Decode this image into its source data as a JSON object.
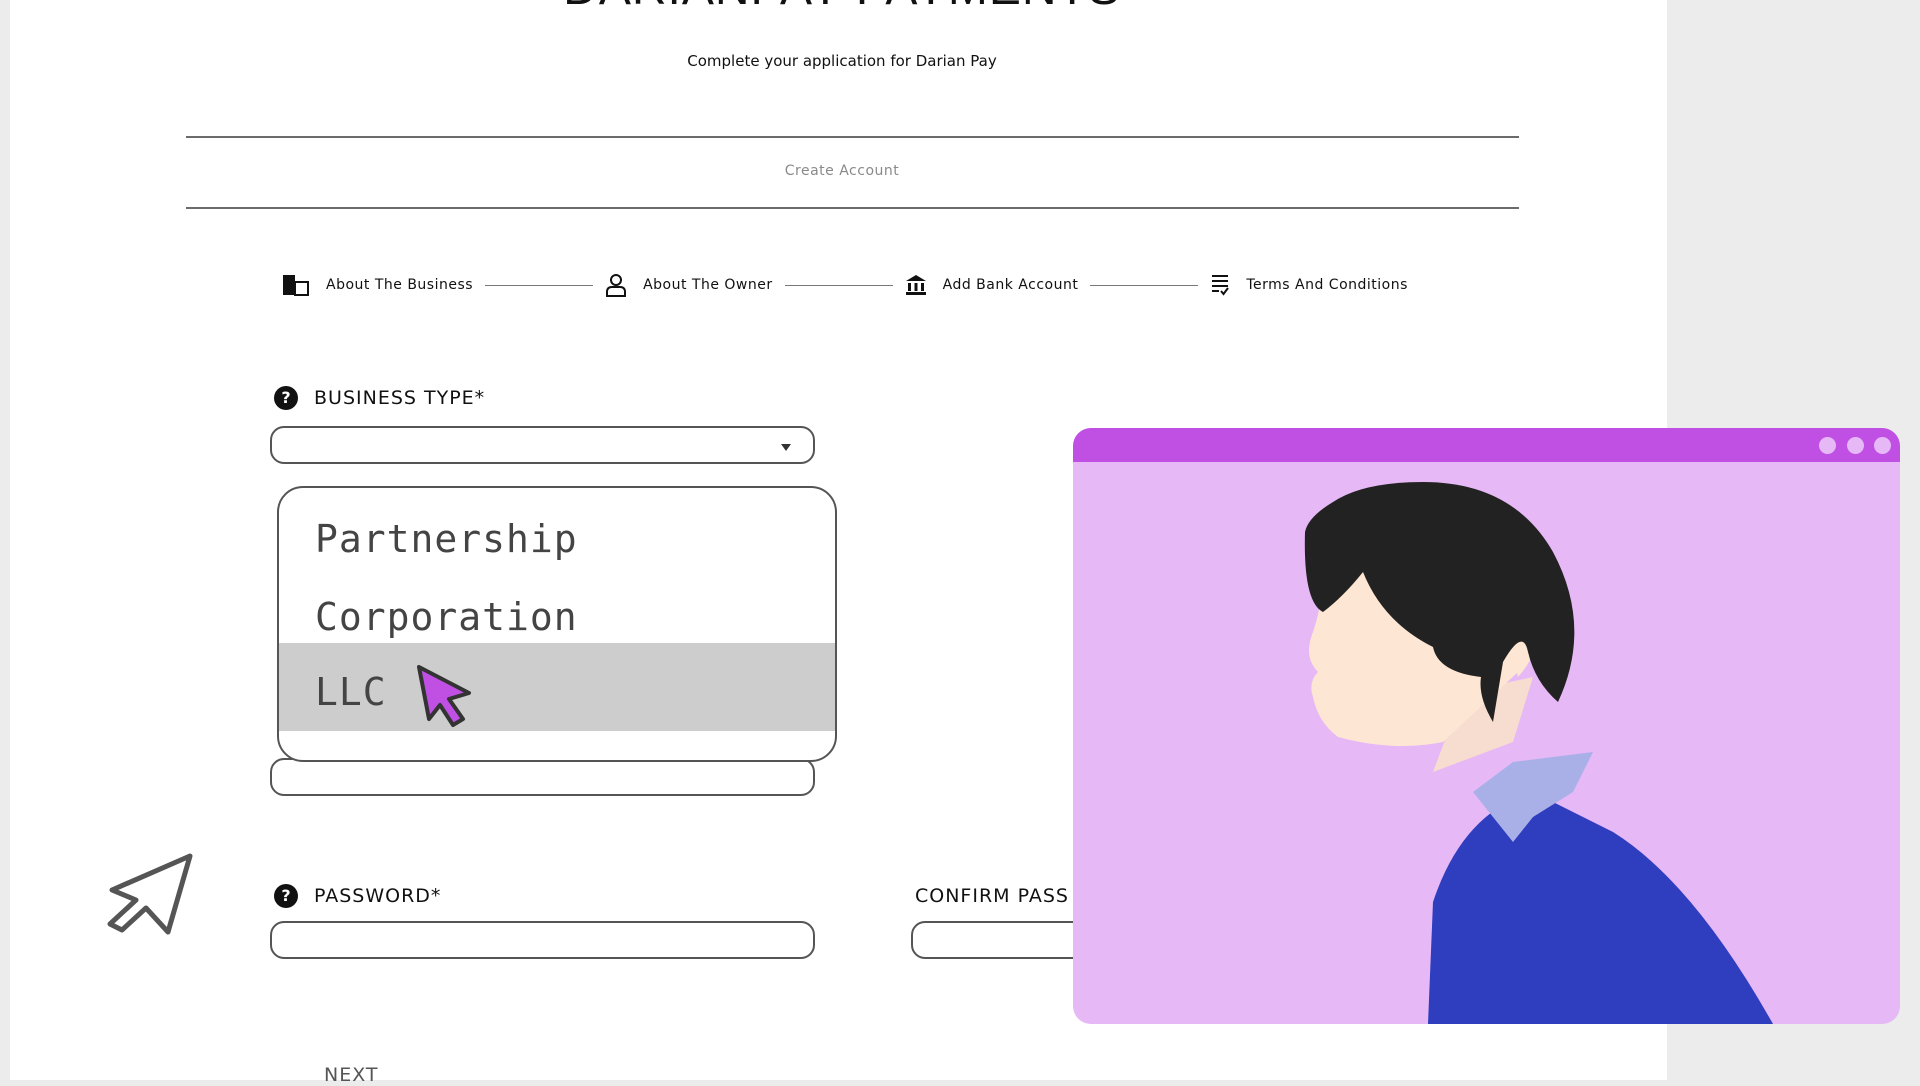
{
  "header": {
    "title": "DARIANPAY PAYMENTS",
    "subtitle": "Complete your application for Darian Pay",
    "section": "Create Account"
  },
  "steps": [
    {
      "label": "About The Business",
      "icon": "business-icon"
    },
    {
      "label": "About The Owner",
      "icon": "person-icon"
    },
    {
      "label": "Add Bank Account",
      "icon": "bank-icon"
    },
    {
      "label": "Terms And Conditions",
      "icon": "terms-list-icon"
    }
  ],
  "form": {
    "business_type_label": "BUSINESS TYPE*",
    "business_type_value": "",
    "business_type_options": [
      "Partnership",
      "Corporation",
      "LLC"
    ],
    "business_type_hovered": "LLC",
    "password_label": "PASSWORD*",
    "confirm_password_label": "CONFIRM PASS",
    "next_label": "NEXT"
  },
  "colors": {
    "accent": "#c050e4",
    "overlay_bg": "#e6b8f5",
    "option_highlight": "#cdcdcd"
  }
}
